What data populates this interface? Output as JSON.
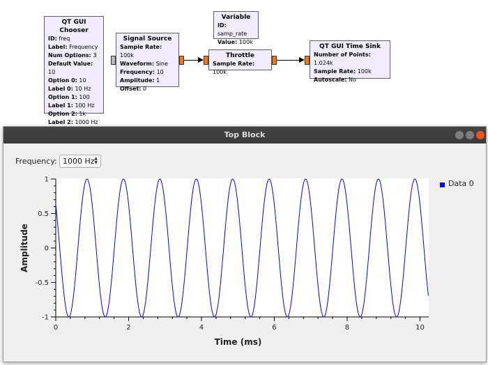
{
  "blocks": {
    "chooser": {
      "title": "QT GUI Chooser",
      "rows": [
        {
          "k": "ID:",
          "v": "freq"
        },
        {
          "k": "Label:",
          "v": "Frequency"
        },
        {
          "k": "Num Options:",
          "v": "3"
        },
        {
          "k": "Default Value:",
          "v": "10"
        },
        {
          "k": "Option 0:",
          "v": "10"
        },
        {
          "k": "Label 0:",
          "v": "10 Hz"
        },
        {
          "k": "Option 1:",
          "v": "100"
        },
        {
          "k": "Label 1:",
          "v": "100 Hz"
        },
        {
          "k": "Option 2:",
          "v": "1k"
        },
        {
          "k": "Label 2:",
          "v": "1000 Hz"
        }
      ]
    },
    "variable": {
      "title": "Variable",
      "rows": [
        {
          "k": "ID:",
          "v": "samp_rate"
        },
        {
          "k": "Value:",
          "v": "100k"
        }
      ]
    },
    "signal_source": {
      "title": "Signal Source",
      "rows": [
        {
          "k": "Sample Rate:",
          "v": "100k"
        },
        {
          "k": "Waveform:",
          "v": "Sine"
        },
        {
          "k": "Frequency:",
          "v": "10"
        },
        {
          "k": "Amplitude:",
          "v": "1"
        },
        {
          "k": "Offset:",
          "v": "0"
        }
      ]
    },
    "throttle": {
      "title": "Throttle",
      "rows": [
        {
          "k": "Sample Rate:",
          "v": "100k"
        }
      ]
    },
    "time_sink": {
      "title": "QT GUI Time Sink",
      "rows": [
        {
          "k": "Number of Points:",
          "v": "1.024k"
        },
        {
          "k": "Sample Rate:",
          "v": "100k"
        },
        {
          "k": "Autoscale:",
          "v": "No"
        }
      ]
    }
  },
  "window": {
    "title": "Top Block",
    "frequency_label": "Frequency:",
    "frequency_value": "1000 Hz",
    "button_colors": {
      "minimize": "#7d7d7d",
      "maximize": "#7d7d7d",
      "close": "#e95420"
    }
  },
  "chart_data": {
    "type": "line",
    "xlabel": "Time (ms)",
    "ylabel": "Amplitude",
    "xlim": [
      0,
      10.24
    ],
    "ylim": [
      -1,
      1
    ],
    "x_ticks": [
      "0",
      "2",
      "4",
      "6",
      "8",
      "10"
    ],
    "x_tick_values": [
      0,
      2,
      4,
      6,
      8,
      10
    ],
    "y_ticks": [
      "1",
      "0.5",
      "0",
      "-0.5",
      "-1"
    ],
    "y_tick_values": [
      1,
      0.5,
      0,
      -0.5,
      -1
    ],
    "grid": false,
    "legend": "right",
    "series": [
      {
        "name": "Data 0",
        "color": "#0000ff",
        "function": "sine",
        "frequency_hz": 1000,
        "amplitude": 1,
        "phase_rad": 0.89,
        "x_start": 0,
        "x_end": 10.23
      }
    ]
  }
}
